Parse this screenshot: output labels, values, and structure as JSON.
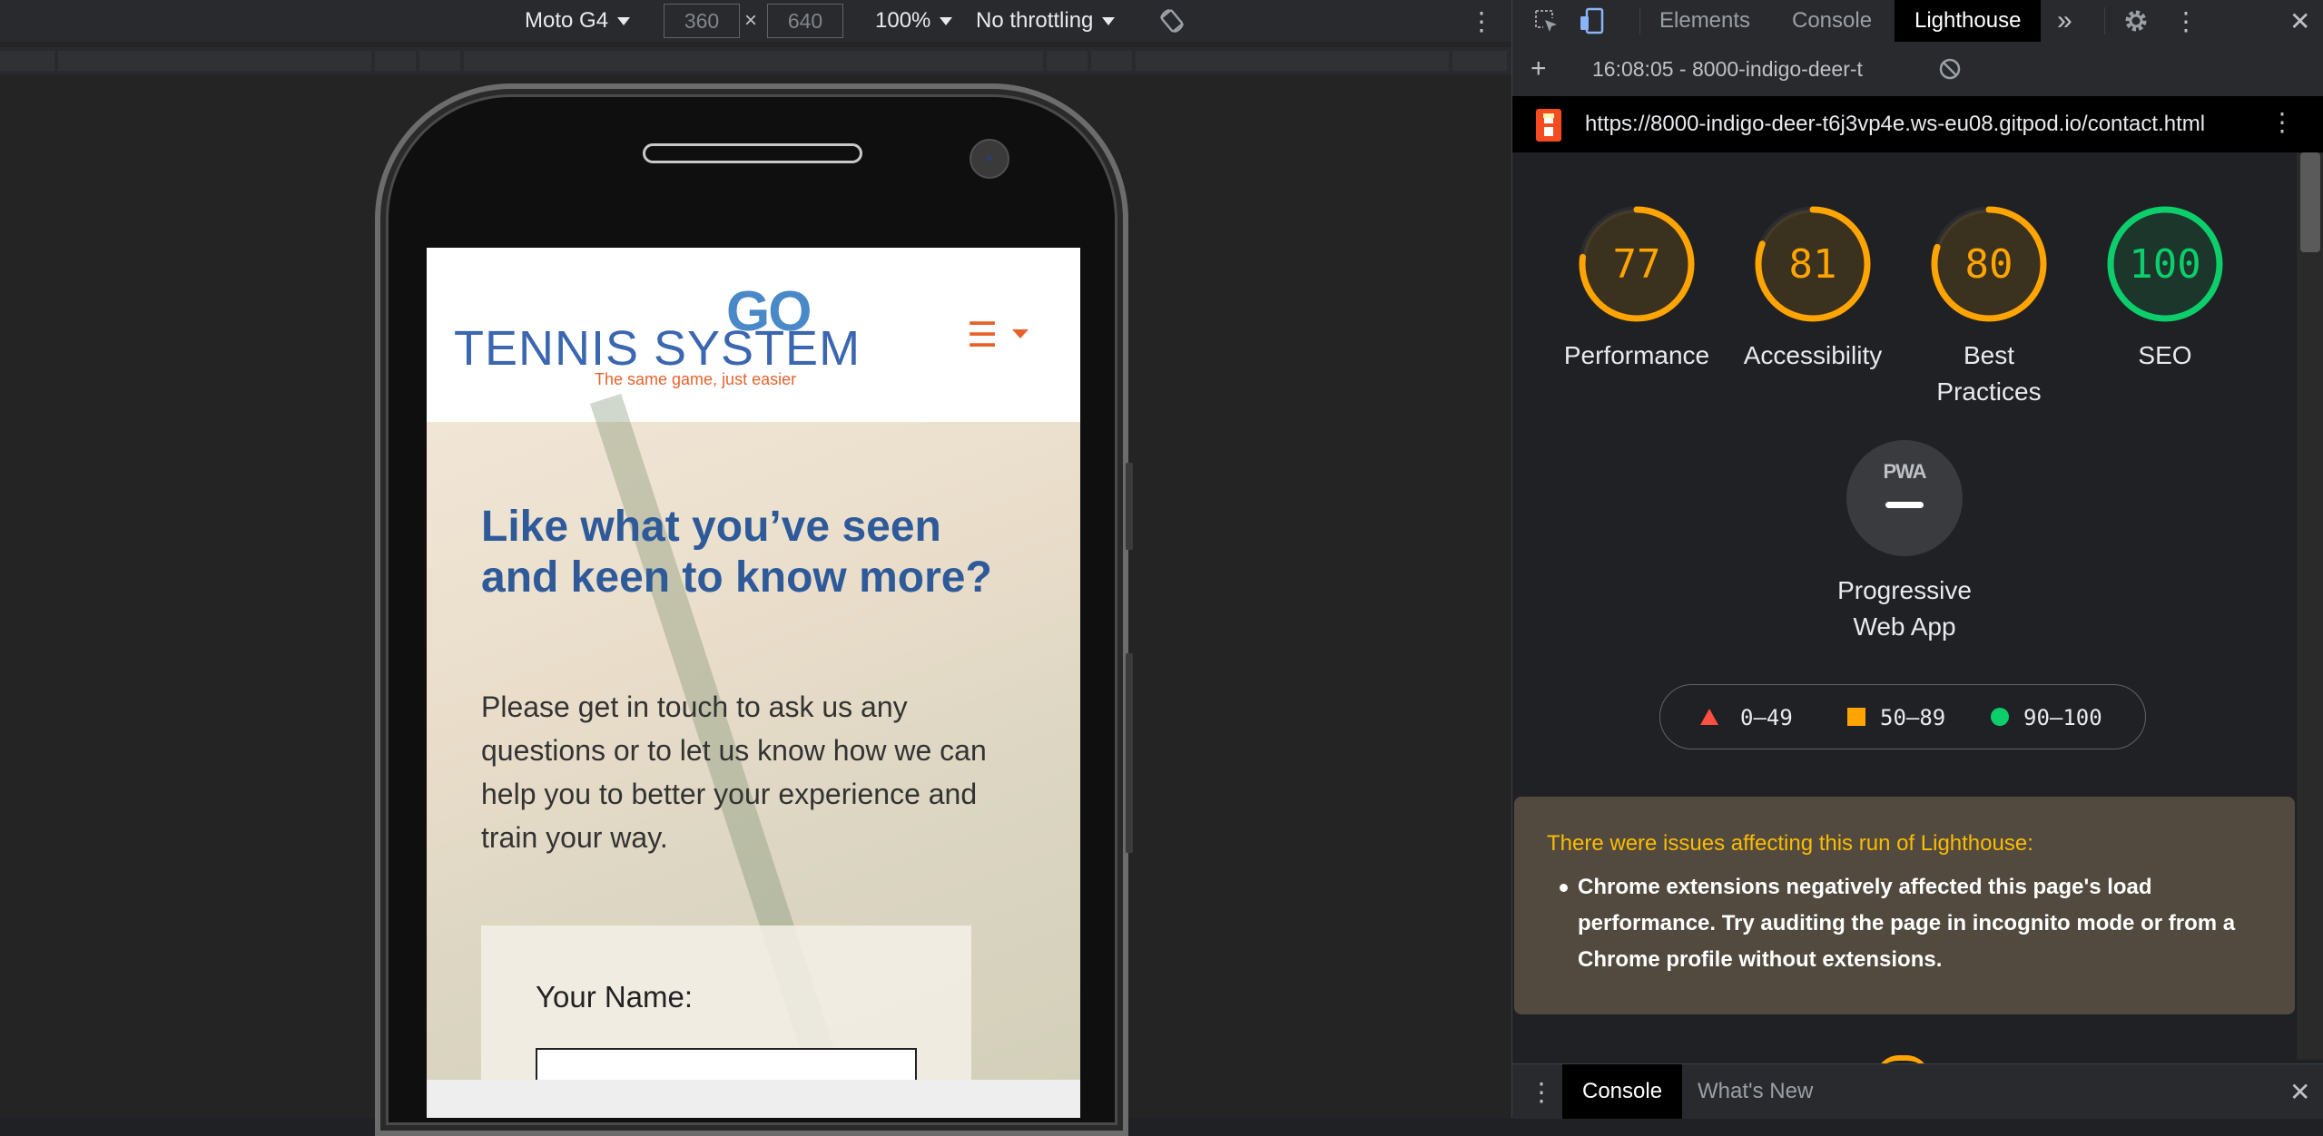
{
  "device_toolbar": {
    "device": "Moto G4",
    "width": "360",
    "times": "×",
    "height": "640",
    "zoom": "100%",
    "throttling": "No throttling"
  },
  "site": {
    "logo_go": "GO",
    "logo_text": "TENNIS SYSTEM",
    "logo_tagline": "The same game, just easier",
    "menu_icon": "☰",
    "headline": "Like what you’ve seen and keen to know more?",
    "intro": "Please get in touch to ask us any questions or to let us know how we can help you to better your experience and train your way.",
    "name_label": "Your Name:"
  },
  "devtools": {
    "tabs": [
      "Elements",
      "Console",
      "Lighthouse"
    ],
    "more": "»",
    "report_label": "16:08:05 - 8000-indigo-deer-t",
    "url": "https://8000-indigo-deer-t6j3vp4e.ws-eu08.gitpod.io/contact.html",
    "scores": [
      {
        "label": "Performance",
        "value": "77",
        "color": "#ffa400"
      },
      {
        "label": "Accessibility",
        "value": "81",
        "color": "#ffa400"
      },
      {
        "label": "Best Practices",
        "value": "80",
        "color": "#ffa400"
      },
      {
        "label": "SEO",
        "value": "100",
        "color": "#0cce6b"
      }
    ],
    "pwa_label": "Progressive Web App",
    "pwa_badge": "PWA",
    "legend": {
      "low": "0–49",
      "mid": "50–89",
      "high": "90–100"
    },
    "warning_title": "There were issues affecting this run of Lighthouse:",
    "warning_item": "Chrome extensions negatively affected this page's load performance. Try auditing the page in incognito mode or from a Chrome profile without extensions.",
    "drawer_tabs": [
      "Console",
      "What's New"
    ]
  },
  "colors": {
    "fail": "#ff4e42",
    "average": "#ffa400",
    "pass": "#0cce6b",
    "accent": "#8ab4f8"
  }
}
